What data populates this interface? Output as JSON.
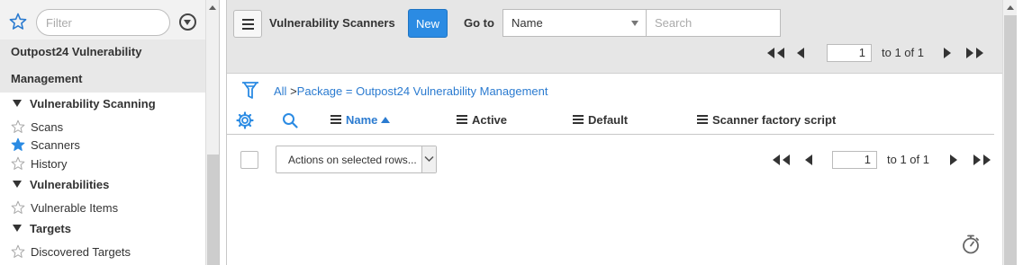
{
  "nav": {
    "filter_placeholder": "Filter",
    "app_title_line1": "Outpost24 Vulnerability",
    "app_title_line2": "Management",
    "sections": [
      {
        "label": "Vulnerability Scanning",
        "items": [
          "Scans",
          "Scanners",
          "History"
        ]
      },
      {
        "label": "Vulnerabilities",
        "items": [
          "Vulnerable Items"
        ]
      },
      {
        "label": "Targets",
        "items": [
          "Discovered Targets"
        ]
      }
    ],
    "active_item": "Scanners",
    "icons": {
      "favorites": "star-outline-icon",
      "filter_menu": "chevron-down-circle-icon",
      "item": "star-outline-icon",
      "active_item": "star-filled-icon"
    }
  },
  "list": {
    "title": "Vulnerability Scanners",
    "new_label": "New",
    "goto_label": "Go to",
    "goto_field": "Name",
    "search_placeholder": "Search",
    "pager_top": {
      "page": "1",
      "of_text": "to 1 of 1"
    },
    "pager_bottom": {
      "page": "1",
      "of_text": "to 1 of 1"
    },
    "breadcrumb": {
      "all": "All",
      "separator": ">",
      "filter": "Package = Outpost24 Vulnerability Management"
    },
    "columns": [
      "Name",
      "Active",
      "Default",
      "Scanner factory script"
    ],
    "sorted_column": "Name",
    "actions_label": "Actions on selected rows..."
  },
  "colors": {
    "accent": "#2b8be3",
    "link": "#2b7bd0",
    "header_bg": "#e6e6e6",
    "nav_bg": "#f2f2f2"
  }
}
